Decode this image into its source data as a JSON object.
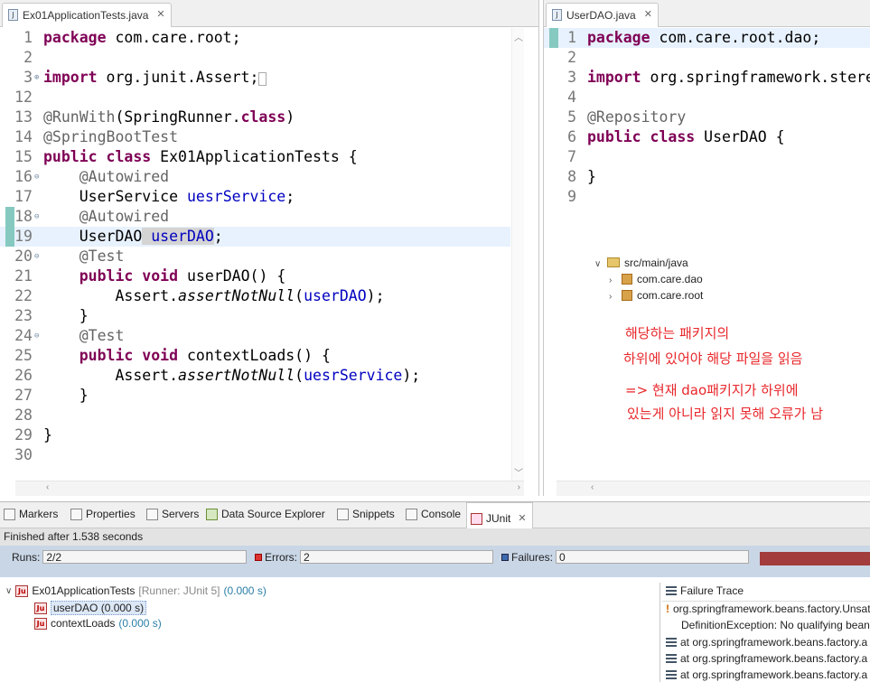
{
  "left_editor": {
    "tab_title": "Ex01ApplicationTests.java",
    "lines": [
      {
        "num": "1",
        "html": "<span class=\"kw\">package</span> com.care.root;"
      },
      {
        "num": "2",
        "html": ""
      },
      {
        "num": "3",
        "fold": "⊕",
        "html": "<span class=\"kw\">import</span> org.junit.Assert;<span style=\"border:1px solid #aaa;font-size:11px;\">&nbsp;</span>"
      },
      {
        "num": "12",
        "html": ""
      },
      {
        "num": "13",
        "html": "<span class=\"an\">@RunWith</span>(SpringRunner.<span class=\"kw\">class</span>)"
      },
      {
        "num": "14",
        "html": "<span class=\"an\">@SpringBootTest</span>"
      },
      {
        "num": "15",
        "html": "<span class=\"kw\">public</span> <span class=\"kw\">class</span> Ex01ApplicationTests {"
      },
      {
        "num": "16",
        "fold": "⊖",
        "html": "    <span class=\"an\">@Autowired</span>"
      },
      {
        "num": "17",
        "html": "    UserService <span class=\"fd\">uesrService</span>;"
      },
      {
        "num": "18",
        "fold": "⊖",
        "marker": true,
        "html": "    <span class=\"an\">@Autowired</span>"
      },
      {
        "num": "19",
        "marker": true,
        "current": true,
        "html": "    UserDAO<span class=\"selhl\"> </span><span class=\"fd selhl\">userDAO</span>;"
      },
      {
        "num": "20",
        "fold": "⊖",
        "html": "    <span class=\"an\">@Test</span>"
      },
      {
        "num": "21",
        "html": "    <span class=\"kw\">public</span> <span class=\"kw\">void</span> userDAO() {"
      },
      {
        "num": "22",
        "html": "        Assert.<span class=\"it\">assertNotNull</span>(<span class=\"fd\">userDAO</span>);"
      },
      {
        "num": "23",
        "html": "    }"
      },
      {
        "num": "24",
        "fold": "⊖",
        "html": "    <span class=\"an\">@Test</span>"
      },
      {
        "num": "25",
        "html": "    <span class=\"kw\">public</span> <span class=\"kw\">void</span> contextLoads() {"
      },
      {
        "num": "26",
        "html": "        Assert.<span class=\"it\">assertNotNull</span>(<span class=\"fd\">uesrService</span>);"
      },
      {
        "num": "27",
        "html": "    }"
      },
      {
        "num": "28",
        "html": ""
      },
      {
        "num": "29",
        "html": "}"
      },
      {
        "num": "30",
        "html": ""
      }
    ]
  },
  "right_editor": {
    "tab_title": "UserDAO.java",
    "lines": [
      {
        "num": "1",
        "current": true,
        "marker": true,
        "html": "<span class=\"kw\">package</span> com.care.root.dao;"
      },
      {
        "num": "2",
        "html": ""
      },
      {
        "num": "3",
        "html": "<span class=\"kw\">import</span> org.springframework.stereotype.Repository;"
      },
      {
        "num": "4",
        "html": ""
      },
      {
        "num": "5",
        "html": "<span class=\"an\">@Repository</span>"
      },
      {
        "num": "6",
        "html": "<span class=\"kw\">public</span> <span class=\"kw\">class</span> UserDAO {"
      },
      {
        "num": "7",
        "html": ""
      },
      {
        "num": "8",
        "html": "}"
      },
      {
        "num": "9",
        "html": ""
      }
    ]
  },
  "package_tree": {
    "root": "src/main/java",
    "children": [
      "com.care.dao",
      "com.care.root"
    ]
  },
  "annotation": {
    "line1": "해당하는 패키지의",
    "line2": "하위에 있어야 해당 파일을 읽음",
    "line3": "=> 현재 dao패키지가 하위에",
    "line4": "있는게 아니라 읽지 못해 오류가 남"
  },
  "panel": {
    "tabs": [
      "Markers",
      "Properties",
      "Servers",
      "Data Source Explorer",
      "Snippets",
      "Console",
      "JUnit"
    ],
    "status": "Finished after 1.538 seconds",
    "runs_label": "Runs:",
    "runs_value": "2/2",
    "errors_label": "Errors:",
    "errors_value": "2",
    "failures_label": "Failures:",
    "failures_value": "0",
    "progress_fraction": 1.0,
    "progress_color": "#a33c3c",
    "suite": {
      "name": "Ex01ApplicationTests",
      "runner": "[Runner: JUnit 5]",
      "time": "(0.000 s)"
    },
    "tests": [
      {
        "name": "userDAO",
        "time": "(0.000 s)"
      },
      {
        "name": "contextLoads",
        "time": "(0.000 s)"
      }
    ],
    "failure_trace": {
      "title": "Failure Trace",
      "lines": [
        "org.springframework.beans.factory.UnsatisfiedDependencyException",
        "DefinitionException: No qualifying bean",
        "at org.springframework.beans.factory.a",
        "at org.springframework.beans.factory.a",
        "at org.springframework.beans.factory.a"
      ]
    }
  }
}
